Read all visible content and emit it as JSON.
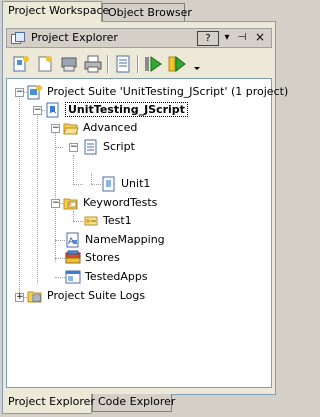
{
  "top_tabs": {
    "workspace": "Project Workspace",
    "object_browser": "Object Browser"
  },
  "panel": {
    "title": "Project Explorer",
    "help_button": "?",
    "options_button": "▾",
    "pin_button": "⊣",
    "close_button": "×"
  },
  "toolbar": {
    "items": [
      "new-project-suite",
      "add-item",
      "open",
      "print",
      "properties",
      "run",
      "run-selected",
      "dropdown"
    ]
  },
  "tree": {
    "suite": "Project Suite 'UnitTesting_JScript' (1 project)",
    "project": "UnitTesting_JScript",
    "advanced": "Advanced",
    "script": "Script",
    "unit1": "Unit1",
    "keywordtests": "KeywordTests",
    "test1": "Test1",
    "namemapping": "NameMapping",
    "stores": "Stores",
    "testedapps": "TestedApps",
    "logs": "Project Suite Logs"
  },
  "bottom_tabs": {
    "project_explorer": "Project Explorer",
    "code_explorer": "Code Explorer"
  },
  "colors": {
    "panel_bg": "#ece9d8",
    "frame": "#d4d0c8",
    "border": "#7f9db9",
    "folder": "#f5cc52",
    "run_green": "#2fa82f"
  }
}
